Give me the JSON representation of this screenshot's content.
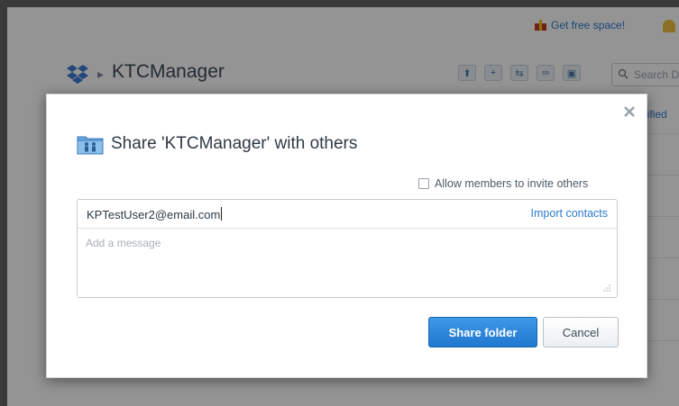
{
  "topbar": {
    "free_space_label": "Get free space!"
  },
  "header": {
    "breadcrumb_separator": "▸",
    "folder_name": "KTCManager",
    "search_placeholder": "Search D",
    "column_modified": "dified"
  },
  "modal": {
    "title": "Share 'KTCManager' with others",
    "allow_invite_label": "Allow members to invite others",
    "allow_invite_checked": false,
    "email_value": "KPTestUser2@email.com",
    "import_contacts_label": "Import contacts",
    "message_placeholder": "Add a message",
    "share_button_label": "Share folder",
    "cancel_button_label": "Cancel"
  },
  "colors": {
    "accent": "#2b7bd1",
    "primary_button": "#2078cf",
    "overlay": "rgba(0,0,0,0.42)"
  },
  "icons": {
    "gift": "gift-icon",
    "bell": "bell-icon",
    "logo": "dropbox-logo",
    "close": "close-icon",
    "shared_folder": "shared-folder-icon",
    "search": "search-icon"
  }
}
